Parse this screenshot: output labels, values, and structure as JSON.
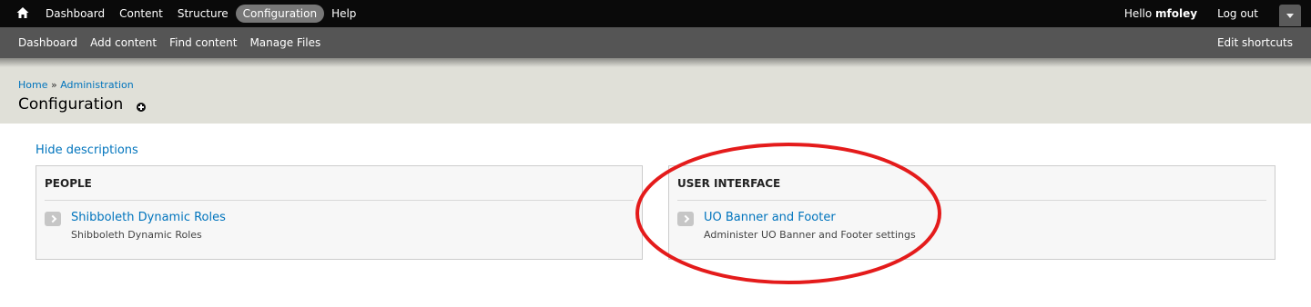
{
  "toolbar": {
    "menu": [
      {
        "label": "Dashboard"
      },
      {
        "label": "Content"
      },
      {
        "label": "Structure"
      },
      {
        "label": "Configuration",
        "active": true
      },
      {
        "label": "Help"
      }
    ],
    "hello_prefix": "Hello ",
    "username": "mfoley",
    "logout_label": "Log out"
  },
  "shortcuts": {
    "items": [
      {
        "label": "Dashboard"
      },
      {
        "label": "Add content"
      },
      {
        "label": "Find content"
      },
      {
        "label": "Manage Files"
      }
    ],
    "edit_label": "Edit shortcuts"
  },
  "header": {
    "breadcrumb": [
      {
        "label": "Home"
      },
      {
        "label": "Administration"
      }
    ],
    "breadcrumb_separator": "»",
    "title": "Configuration"
  },
  "content": {
    "hide_descriptions_label": "Hide descriptions",
    "panels": [
      {
        "title": "PEOPLE",
        "items": [
          {
            "label": "Shibboleth Dynamic Roles",
            "description": "Shibboleth Dynamic Roles"
          }
        ]
      },
      {
        "title": "USER INTERFACE",
        "items": [
          {
            "label": "UO Banner and Footer",
            "description": "Administer UO Banner and Footer settings"
          }
        ]
      }
    ]
  },
  "colors": {
    "link": "#0074bd",
    "highlight_ring": "#e41b1b",
    "toolbar_bg": "#0a0a0a",
    "shortcuts_bg": "#555555",
    "header_bg": "#e0e0d8"
  },
  "icons": {
    "home": "home-icon",
    "drawer": "chevron-down-icon",
    "add_shortcut": "plus-circle-icon",
    "item_arrow": "chevron-right-icon"
  }
}
